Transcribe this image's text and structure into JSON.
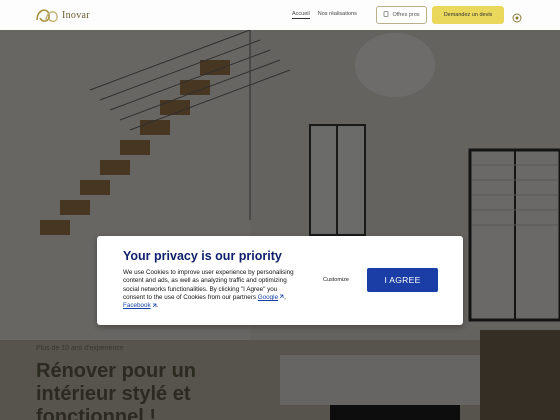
{
  "header": {
    "logo_text": "Inovar",
    "nav": [
      "Accueil",
      "Nos réalisations"
    ],
    "offers_button": "Offres pros",
    "cta_button": "Demandez un devis"
  },
  "hero": {
    "tagline": "Plus de 10 ans d'expérience",
    "title": "Rénover pour un intérieur stylé et fonctionnel !"
  },
  "privacy": {
    "title": "Your privacy is our priority",
    "body_text": "We use Cookies to improve user experience by personalising content and ads, as well as analyzing traffic and optimizing social networks functionalities. By clicking \"I Agree\" you consent to the use of Cookies from our partners",
    "link_google": "Google",
    "link_facebook": "Facebook",
    "separator": ",",
    "end": ".",
    "customize_label": "Customize",
    "agree_label": "I AGREE"
  },
  "colors": {
    "brand_blue": "#10206b",
    "agree_blue": "#1a3ea6",
    "cta_yellow": "#e9d85c"
  },
  "icons": [
    "logo-icon",
    "phone-icon",
    "menu-icon",
    "external-link-icon"
  ]
}
